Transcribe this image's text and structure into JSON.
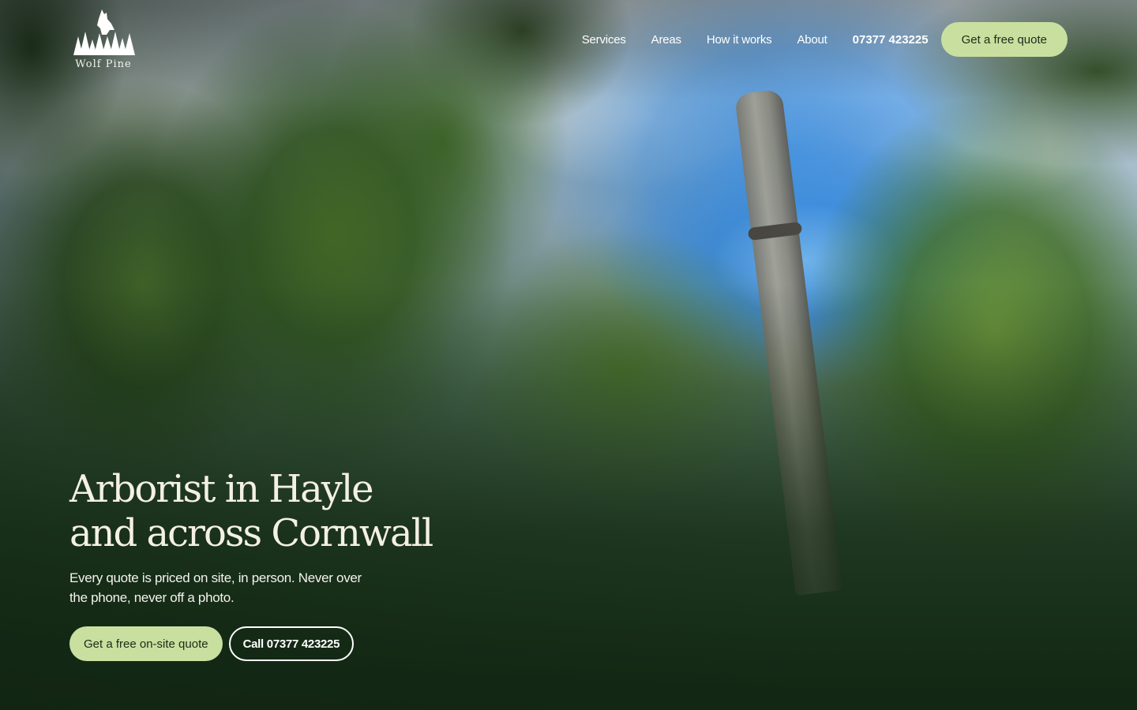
{
  "brand": {
    "name": "Wolf Pine",
    "logo_icon": "wolf-pine-logo-icon"
  },
  "nav": {
    "items": [
      {
        "label": "Services"
      },
      {
        "label": "Areas"
      },
      {
        "label": "How it works"
      },
      {
        "label": "About"
      }
    ],
    "phone": "07377 423225",
    "cta_label": "Get a free quote"
  },
  "hero": {
    "title_line1": "Arborist in Hayle",
    "title_line2": "and across Cornwall",
    "subtitle": "Every quote is priced on site, in person. Never over the phone, never off a photo.",
    "primary_cta": "Get a free on-site quote",
    "secondary_cta": "Call 07377 423225"
  },
  "colors": {
    "accent": "#c8dfa0",
    "accent_text": "#1d2b17",
    "heading_text": "#f4f0e4"
  }
}
